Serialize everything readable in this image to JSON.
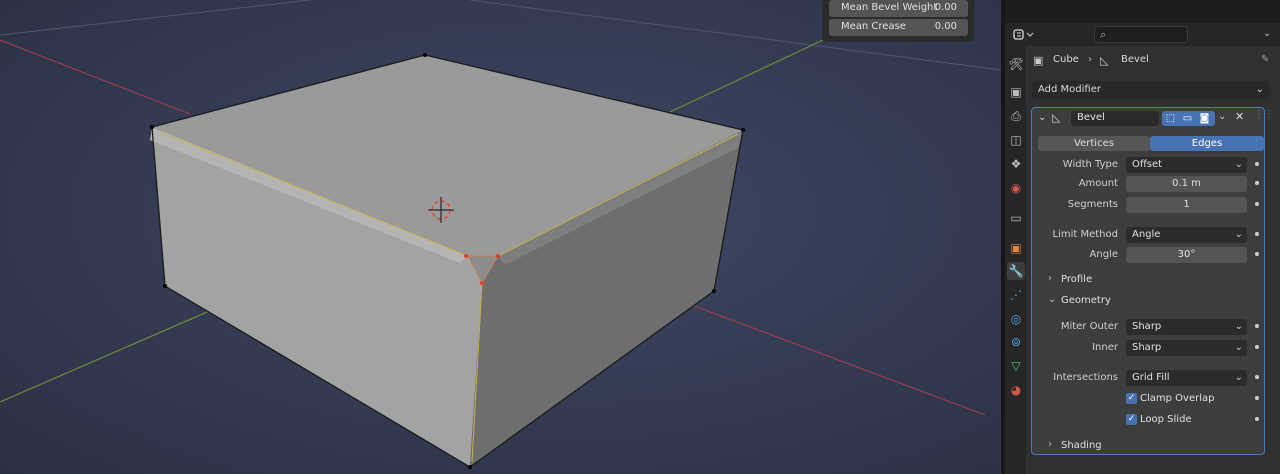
{
  "overlay": {
    "mean_bevel_weight": {
      "label": "Mean Bevel Weight",
      "value": "0.00"
    },
    "mean_crease": {
      "label": "Mean Crease",
      "value": "0.00"
    }
  },
  "breadcrumb": {
    "object": "Cube",
    "modifier": "Bevel"
  },
  "add_modifier": "Add Modifier",
  "modifier": {
    "name": "Bevel",
    "affect_options": [
      "Vertices",
      "Edges"
    ],
    "affect_selected": "Edges",
    "width_type": {
      "label": "Width Type",
      "value": "Offset"
    },
    "amount": {
      "label": "Amount",
      "value": "0.1 m"
    },
    "segments": {
      "label": "Segments",
      "value": "1"
    },
    "limit_method": {
      "label": "Limit Method",
      "value": "Angle"
    },
    "angle": {
      "label": "Angle",
      "value": "30°"
    },
    "profile": "Profile",
    "geometry": "Geometry",
    "miter_outer": {
      "label": "Miter Outer",
      "value": "Sharp"
    },
    "inner": {
      "label": "Inner",
      "value": "Sharp"
    },
    "intersections": {
      "label": "Intersections",
      "value": "Grid Fill"
    },
    "clamp_overlap": {
      "label": "Clamp Overlap",
      "checked": true
    },
    "loop_slide": {
      "label": "Loop Slide",
      "checked": true
    },
    "shading": "Shading"
  },
  "colors": {
    "accent": "#4772b3",
    "panel": "#3d3d3d",
    "viewport": "#353c55"
  },
  "icons": [
    "editor-type-icon",
    "search-icon",
    "mesh-object-icon",
    "bevel-modifier-icon",
    "pin-icon",
    "edit-mode-icon",
    "realtime-icon",
    "render-icon",
    "close-icon",
    "wrench-icon"
  ]
}
